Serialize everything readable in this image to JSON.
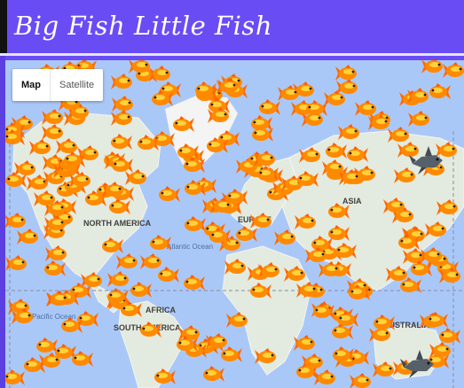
{
  "header": {
    "title": "Big Fish Little Fish"
  },
  "map_controls": {
    "map_label": "Map",
    "satellite_label": "Satellite",
    "selected": "Map"
  },
  "map_labels": {
    "north_america": "NORTH AMERICA",
    "europe": "EUROPE",
    "asia": "ASIA",
    "africa": "AFRICA",
    "south_america": "SOUTH AMERICA",
    "australia": "AUSTRALIA",
    "atlantic_ocean": "Atlantic Ocean",
    "pacific_ocean": "Pacific Ocean"
  },
  "colors": {
    "header": "#6a4cf5",
    "ocean": "#aac8f7",
    "land": "#e3eadf",
    "fish": "#ff8a00"
  },
  "sharks": [
    {
      "name": "shark-icon-asia"
    },
    {
      "name": "shark-icon-south-pacific"
    }
  ]
}
